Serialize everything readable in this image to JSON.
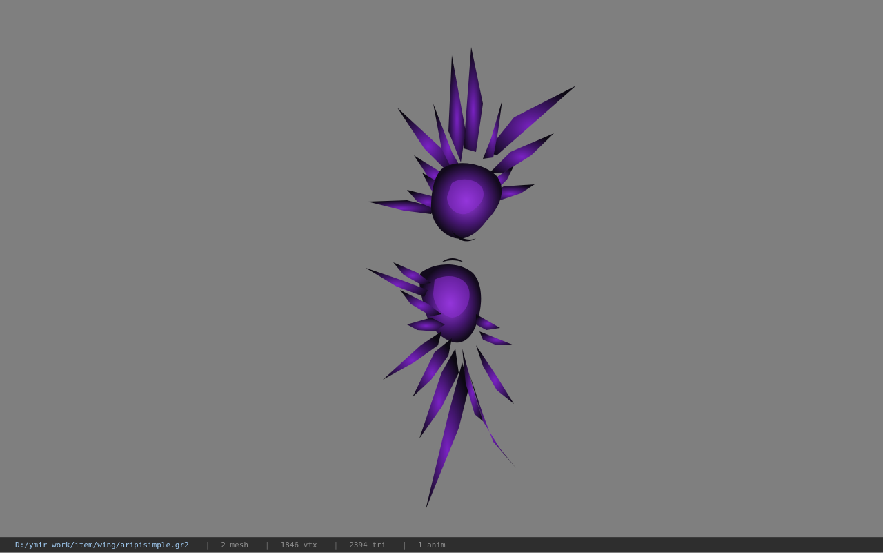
{
  "viewport": {
    "background": "#7f7f7f",
    "model": {
      "name": "aripisimple",
      "feather_color": "#8a2ed0",
      "shadow_color": "#0b0710"
    }
  },
  "status": {
    "path": "D:/ymir work/item/wing/aripisimple.gr2",
    "separator": "|",
    "mesh": "2 mesh",
    "vtx": "1846 vtx",
    "tri": "2394 tri",
    "anim": "1 anim"
  }
}
